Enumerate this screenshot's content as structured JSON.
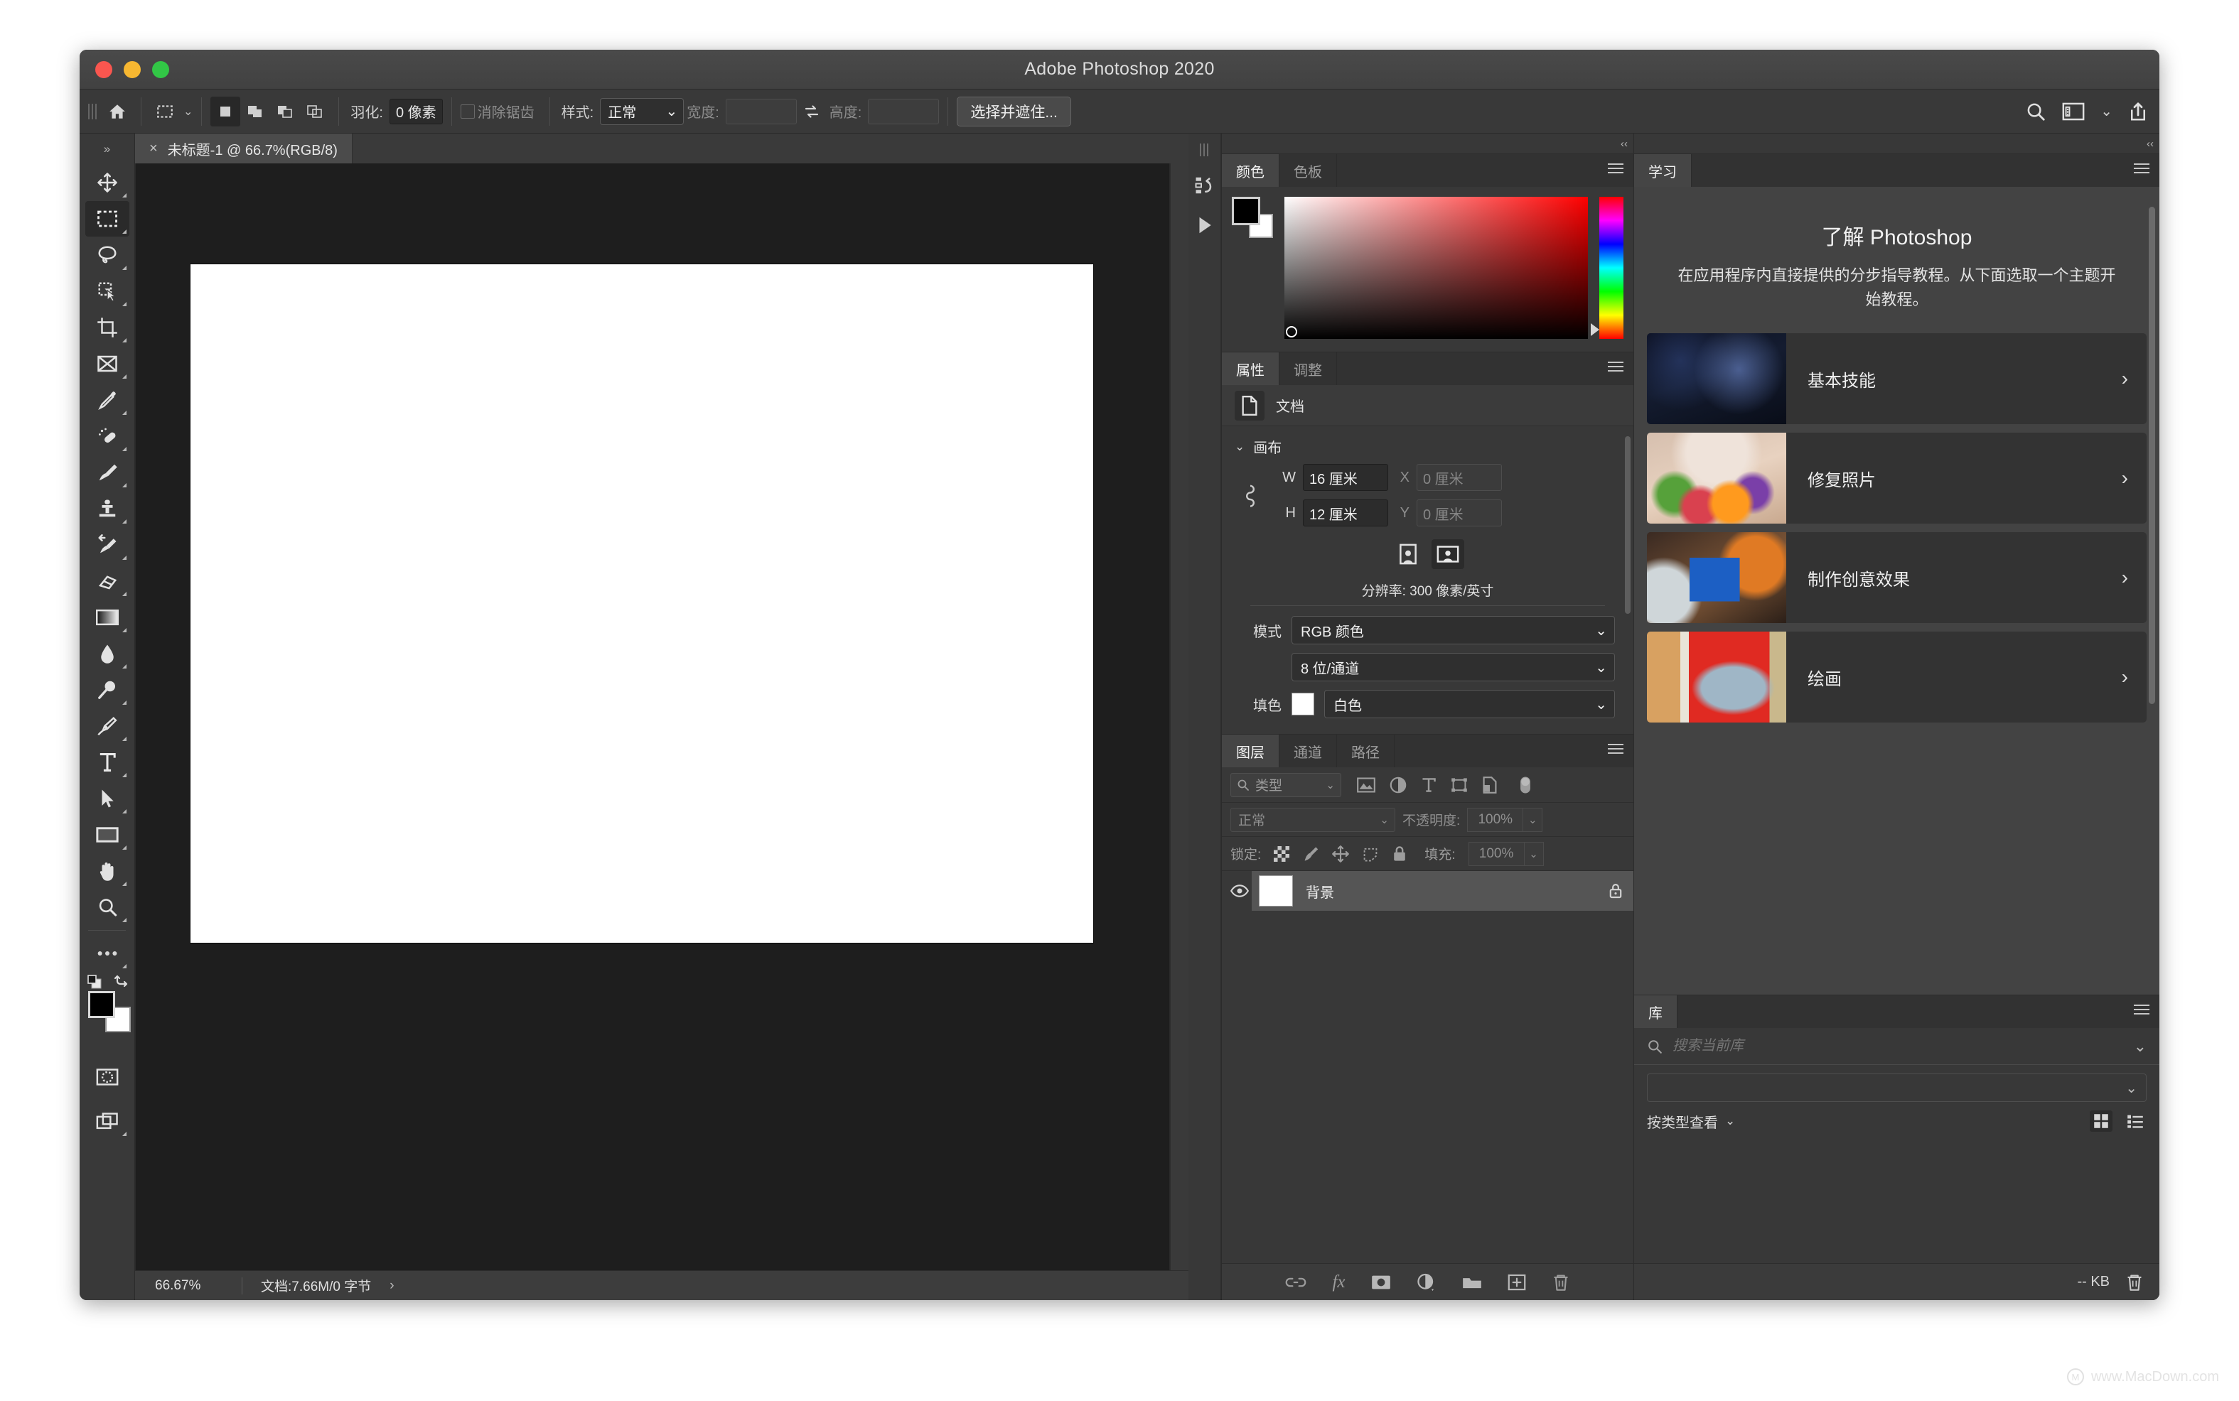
{
  "window": {
    "title": "Adobe Photoshop 2020",
    "traffic_lights": [
      "close",
      "minimize",
      "zoom"
    ]
  },
  "options_bar": {
    "home_icon": "home-icon",
    "tool_preset_icon": "marquee-tool-icon",
    "selection_modes": [
      "new-selection",
      "add-to-selection",
      "subtract-from-selection",
      "intersect-selection"
    ],
    "feather_label": "羽化:",
    "feather_value": "0 像素",
    "antialias_label": "消除锯齿",
    "style_label": "样式:",
    "style_value": "正常",
    "width_label": "宽度:",
    "width_value": "",
    "swap_icon": "swap-arrows-icon",
    "height_label": "高度:",
    "height_value": "",
    "select_and_mask_label": "选择并遮住...",
    "right_icons": [
      "search-icon",
      "workspace-icon",
      "chevron-down-icon",
      "share-icon"
    ]
  },
  "toolbar": {
    "expand_label": "»",
    "tools": [
      {
        "name": "move-tool",
        "icon": "move-arrows-icon",
        "active": false
      },
      {
        "name": "rectangular-marquee-tool",
        "icon": "marquee-dashed-rect-icon",
        "active": true
      },
      {
        "name": "lasso-tool",
        "icon": "lasso-icon",
        "active": false
      },
      {
        "name": "quick-selection-tool",
        "icon": "quick-selection-icon",
        "active": false
      },
      {
        "name": "crop-tool",
        "icon": "crop-icon",
        "active": false
      },
      {
        "name": "frame-tool",
        "icon": "frame-icon",
        "active": false
      },
      {
        "name": "eyedropper-tool",
        "icon": "eyedropper-icon",
        "active": false
      },
      {
        "name": "spot-healing-brush-tool",
        "icon": "healing-bandage-icon",
        "active": false
      },
      {
        "name": "brush-tool",
        "icon": "paintbrush-icon",
        "active": false
      },
      {
        "name": "clone-stamp-tool",
        "icon": "clone-stamp-icon",
        "active": false
      },
      {
        "name": "history-brush-tool",
        "icon": "history-brush-icon",
        "active": false
      },
      {
        "name": "eraser-tool",
        "icon": "eraser-icon",
        "active": false
      },
      {
        "name": "gradient-tool",
        "icon": "gradient-icon",
        "active": false
      },
      {
        "name": "blur-tool",
        "icon": "waterdrop-icon",
        "active": false
      },
      {
        "name": "dodge-tool",
        "icon": "dodge-lollipop-icon",
        "active": false
      },
      {
        "name": "pen-tool",
        "icon": "pen-nib-icon",
        "active": false
      },
      {
        "name": "type-tool",
        "icon": "type-T-icon",
        "active": false
      },
      {
        "name": "path-selection-tool",
        "icon": "path-arrow-icon",
        "active": false
      },
      {
        "name": "rectangle-tool",
        "icon": "rectangle-shape-icon",
        "active": false
      },
      {
        "name": "hand-tool",
        "icon": "hand-icon",
        "active": false
      },
      {
        "name": "zoom-tool",
        "icon": "magnifier-icon",
        "active": false
      },
      {
        "name": "edit-toolbar-button",
        "icon": "ellipsis-icon",
        "active": false
      }
    ],
    "foreground_color": "#000000",
    "background_color": "#ffffff",
    "default_colors_icon": "default-colors-icon",
    "swap_colors_icon": "swap-colors-icon",
    "quick_mask_icon": "quick-mask-icon",
    "screen_mode_icon": "screen-mode-icon"
  },
  "document": {
    "tab_label": "未标题-1 @ 66.7%(RGB/8)",
    "close_icon": "close-icon",
    "canvas_fill": "#ffffff"
  },
  "status_bar": {
    "zoom": "66.67%",
    "doc_info": "文档:7.66M/0 字节",
    "arrow_icon": "chevron-right-icon"
  },
  "color_panel": {
    "tabs": [
      {
        "label": "颜色",
        "active": true
      },
      {
        "label": "色板",
        "active": false
      }
    ],
    "menu_icon": "panel-menu-icon",
    "foreground": "#000000",
    "background": "#ffffff",
    "hue_base": "#ff0000"
  },
  "properties_panel": {
    "tabs": [
      {
        "label": "属性",
        "active": true
      },
      {
        "label": "调整",
        "active": false
      }
    ],
    "menu_icon": "panel-menu-icon",
    "doc_icon": "document-page-icon",
    "doc_label": "文档",
    "section_title": "画布",
    "section_chevron": "chevron-down-icon",
    "link_icon": "link-dimensions-icon",
    "fields": {
      "w_label": "W",
      "w_value": "16 厘米",
      "h_label": "H",
      "h_value": "12 厘米",
      "x_label": "X",
      "x_value": "0 厘米",
      "y_label": "Y",
      "y_value": "0 厘米"
    },
    "orientation": [
      {
        "name": "portrait-orientation",
        "active": false
      },
      {
        "name": "landscape-orientation",
        "active": true
      }
    ],
    "resolution_line": "分辨率: 300 像素/英寸",
    "mode_label": "模式",
    "mode_value": "RGB 颜色",
    "depth_value": "8 位/通道",
    "fill_label": "填色",
    "fill_swatch": "#ffffff",
    "fill_value": "白色"
  },
  "layers_panel": {
    "tabs": [
      {
        "label": "图层",
        "active": true
      },
      {
        "label": "通道",
        "active": false
      },
      {
        "label": "路径",
        "active": false
      }
    ],
    "menu_icon": "panel-menu-icon",
    "filter_label": "类型",
    "filter_search_icon": "search-icon",
    "filter_icons": [
      "pixel-layers-filter-icon",
      "adjustment-layers-filter-icon",
      "type-layers-filter-icon",
      "shape-layers-filter-icon",
      "smart-object-filter-icon"
    ],
    "filter_toggle": "filter-toggle-icon",
    "blend_mode": "正常",
    "opacity_label": "不透明度:",
    "opacity_value": "100%",
    "lock_label": "锁定:",
    "lock_icons": [
      "lock-transparent-pixels-icon",
      "lock-image-pixels-icon",
      "lock-position-icon",
      "lock-artboard-nesting-icon",
      "lock-all-icon"
    ],
    "fill_label": "填充:",
    "fill_value": "100%",
    "layers": [
      {
        "name": "背景",
        "visible": true,
        "locked": true,
        "thumb_color": "#ffffff",
        "selected": true,
        "eye_icon": "eye-icon",
        "lock_icon": "lock-icon"
      }
    ],
    "bottom_icons": [
      "link-layers-icon",
      "layer-style-fx-icon",
      "layer-mask-icon",
      "adjustment-layer-icon",
      "new-group-icon",
      "new-layer-icon",
      "delete-layer-icon"
    ]
  },
  "learn_panel": {
    "tab_label": "学习",
    "menu_icon": "panel-menu-icon",
    "title": "了解 Photoshop",
    "subtitle": "在应用程序内直接提供的分步指导教程。从下面选取一个主题开始教程。",
    "tutorials": [
      {
        "label": "基本技能",
        "arrow": "chevron-right-icon",
        "thumb": "dark-room-night-photo"
      },
      {
        "label": "修复照片",
        "arrow": "chevron-right-icon",
        "thumb": "florist-flowers-photo"
      },
      {
        "label": "制作创意效果",
        "arrow": "chevron-right-icon",
        "thumb": "blue-pencil-art-photo"
      },
      {
        "label": "绘画",
        "arrow": "chevron-right-icon",
        "thumb": "red-fish-illustration"
      }
    ]
  },
  "libraries_panel": {
    "tab_label": "库",
    "menu_icon": "panel-menu-icon",
    "search_icon": "search-icon",
    "search_placeholder": "搜索当前库",
    "search_value": "",
    "search_caret": "chevron-down-icon",
    "library_select_value": "",
    "view_label": "按类型查看",
    "view_caret": "chevron-down-icon",
    "view_modes": [
      {
        "name": "grid-view-icon",
        "active": true
      },
      {
        "name": "list-view-icon",
        "active": false
      }
    ],
    "size_label": "-- KB",
    "delete_icon": "trash-icon"
  },
  "watermark": {
    "text": "www.MacDown.com",
    "mark": "M"
  }
}
